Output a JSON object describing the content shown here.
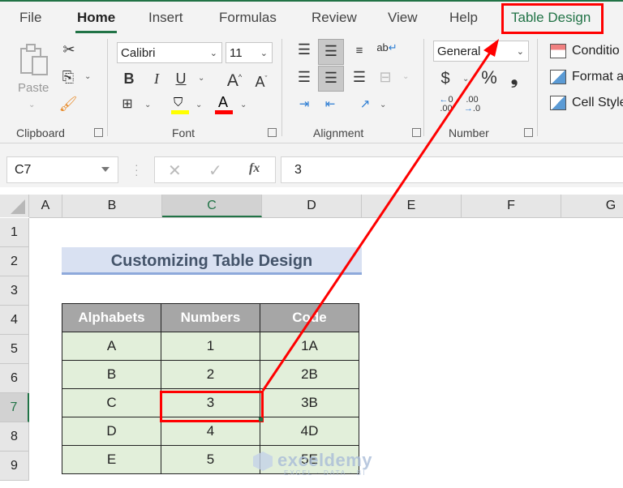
{
  "ribbon_tabs": [
    {
      "label": "File"
    },
    {
      "label": "Home",
      "active": true
    },
    {
      "label": "Insert"
    },
    {
      "label": "Formulas"
    },
    {
      "label": "Review"
    },
    {
      "label": "View"
    },
    {
      "label": "Help"
    },
    {
      "label": "Table Design",
      "highlighted": true
    }
  ],
  "clipboard": {
    "paste_label": "Paste",
    "group_label": "Clipboard"
  },
  "font": {
    "name": "Calibri",
    "size": "11",
    "group_label": "Font",
    "bold": "B",
    "italic": "I",
    "underline": "U",
    "grow": "A",
    "shrink": "A",
    "font_color": "A",
    "highlight_color": "#ffff00",
    "font_color_hex": "#ff0000"
  },
  "alignment": {
    "group_label": "Alignment",
    "wrap": "ab"
  },
  "number": {
    "format": "General",
    "group_label": "Number",
    "currency": "$",
    "percent": "%",
    "comma": "❟",
    "inc_decimal": ".00",
    "dec_decimal": ".00"
  },
  "styles": {
    "conditional": "Conditio",
    "format_as_table": "Format a",
    "cell_styles": "Cell Style"
  },
  "formula_bar": {
    "name_box": "C7",
    "fx": "fx",
    "value": "3"
  },
  "columns": [
    "A",
    "B",
    "C",
    "D",
    "E",
    "F",
    "G"
  ],
  "selected_column": "C",
  "rows": [
    "1",
    "2",
    "3",
    "4",
    "5",
    "6",
    "7",
    "8",
    "9"
  ],
  "selected_row": "7",
  "sheet": {
    "title": "Customizing Table Design",
    "table": {
      "headers": [
        "Alphabets",
        "Numbers",
        "Code"
      ],
      "rows": [
        [
          "A",
          "1",
          "1A"
        ],
        [
          "B",
          "2",
          "2B"
        ],
        [
          "C",
          "3",
          "3B"
        ],
        [
          "D",
          "4",
          "4D"
        ],
        [
          "E",
          "5",
          "5E"
        ]
      ]
    }
  },
  "watermark": {
    "main": "exceldemy",
    "sub": "EXCEL · DATA · BI"
  },
  "colors": {
    "accent": "#217346",
    "annotation": "#ff0000",
    "header_fill": "#a6a6a6",
    "row_fill": "#e2efda",
    "title_fill": "#d9e1f2"
  }
}
